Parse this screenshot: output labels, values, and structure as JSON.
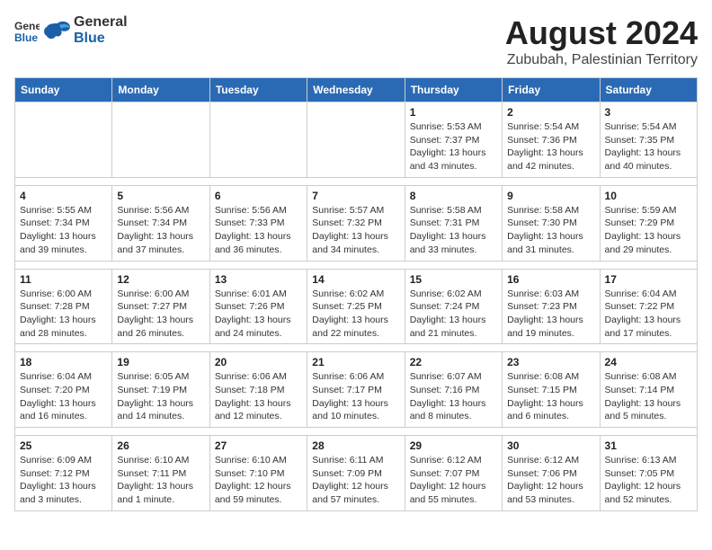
{
  "header": {
    "logo_line1": "General",
    "logo_line2": "Blue",
    "main_title": "August 2024",
    "subtitle": "Zububah, Palestinian Territory"
  },
  "days_of_week": [
    "Sunday",
    "Monday",
    "Tuesday",
    "Wednesday",
    "Thursday",
    "Friday",
    "Saturday"
  ],
  "weeks": [
    {
      "days": [
        {
          "num": "",
          "info": ""
        },
        {
          "num": "",
          "info": ""
        },
        {
          "num": "",
          "info": ""
        },
        {
          "num": "",
          "info": ""
        },
        {
          "num": "1",
          "info": "Sunrise: 5:53 AM\nSunset: 7:37 PM\nDaylight: 13 hours\nand 43 minutes."
        },
        {
          "num": "2",
          "info": "Sunrise: 5:54 AM\nSunset: 7:36 PM\nDaylight: 13 hours\nand 42 minutes."
        },
        {
          "num": "3",
          "info": "Sunrise: 5:54 AM\nSunset: 7:35 PM\nDaylight: 13 hours\nand 40 minutes."
        }
      ]
    },
    {
      "days": [
        {
          "num": "4",
          "info": "Sunrise: 5:55 AM\nSunset: 7:34 PM\nDaylight: 13 hours\nand 39 minutes."
        },
        {
          "num": "5",
          "info": "Sunrise: 5:56 AM\nSunset: 7:34 PM\nDaylight: 13 hours\nand 37 minutes."
        },
        {
          "num": "6",
          "info": "Sunrise: 5:56 AM\nSunset: 7:33 PM\nDaylight: 13 hours\nand 36 minutes."
        },
        {
          "num": "7",
          "info": "Sunrise: 5:57 AM\nSunset: 7:32 PM\nDaylight: 13 hours\nand 34 minutes."
        },
        {
          "num": "8",
          "info": "Sunrise: 5:58 AM\nSunset: 7:31 PM\nDaylight: 13 hours\nand 33 minutes."
        },
        {
          "num": "9",
          "info": "Sunrise: 5:58 AM\nSunset: 7:30 PM\nDaylight: 13 hours\nand 31 minutes."
        },
        {
          "num": "10",
          "info": "Sunrise: 5:59 AM\nSunset: 7:29 PM\nDaylight: 13 hours\nand 29 minutes."
        }
      ]
    },
    {
      "days": [
        {
          "num": "11",
          "info": "Sunrise: 6:00 AM\nSunset: 7:28 PM\nDaylight: 13 hours\nand 28 minutes."
        },
        {
          "num": "12",
          "info": "Sunrise: 6:00 AM\nSunset: 7:27 PM\nDaylight: 13 hours\nand 26 minutes."
        },
        {
          "num": "13",
          "info": "Sunrise: 6:01 AM\nSunset: 7:26 PM\nDaylight: 13 hours\nand 24 minutes."
        },
        {
          "num": "14",
          "info": "Sunrise: 6:02 AM\nSunset: 7:25 PM\nDaylight: 13 hours\nand 22 minutes."
        },
        {
          "num": "15",
          "info": "Sunrise: 6:02 AM\nSunset: 7:24 PM\nDaylight: 13 hours\nand 21 minutes."
        },
        {
          "num": "16",
          "info": "Sunrise: 6:03 AM\nSunset: 7:23 PM\nDaylight: 13 hours\nand 19 minutes."
        },
        {
          "num": "17",
          "info": "Sunrise: 6:04 AM\nSunset: 7:22 PM\nDaylight: 13 hours\nand 17 minutes."
        }
      ]
    },
    {
      "days": [
        {
          "num": "18",
          "info": "Sunrise: 6:04 AM\nSunset: 7:20 PM\nDaylight: 13 hours\nand 16 minutes."
        },
        {
          "num": "19",
          "info": "Sunrise: 6:05 AM\nSunset: 7:19 PM\nDaylight: 13 hours\nand 14 minutes."
        },
        {
          "num": "20",
          "info": "Sunrise: 6:06 AM\nSunset: 7:18 PM\nDaylight: 13 hours\nand 12 minutes."
        },
        {
          "num": "21",
          "info": "Sunrise: 6:06 AM\nSunset: 7:17 PM\nDaylight: 13 hours\nand 10 minutes."
        },
        {
          "num": "22",
          "info": "Sunrise: 6:07 AM\nSunset: 7:16 PM\nDaylight: 13 hours\nand 8 minutes."
        },
        {
          "num": "23",
          "info": "Sunrise: 6:08 AM\nSunset: 7:15 PM\nDaylight: 13 hours\nand 6 minutes."
        },
        {
          "num": "24",
          "info": "Sunrise: 6:08 AM\nSunset: 7:14 PM\nDaylight: 13 hours\nand 5 minutes."
        }
      ]
    },
    {
      "days": [
        {
          "num": "25",
          "info": "Sunrise: 6:09 AM\nSunset: 7:12 PM\nDaylight: 13 hours\nand 3 minutes."
        },
        {
          "num": "26",
          "info": "Sunrise: 6:10 AM\nSunset: 7:11 PM\nDaylight: 13 hours\nand 1 minute."
        },
        {
          "num": "27",
          "info": "Sunrise: 6:10 AM\nSunset: 7:10 PM\nDaylight: 12 hours\nand 59 minutes."
        },
        {
          "num": "28",
          "info": "Sunrise: 6:11 AM\nSunset: 7:09 PM\nDaylight: 12 hours\nand 57 minutes."
        },
        {
          "num": "29",
          "info": "Sunrise: 6:12 AM\nSunset: 7:07 PM\nDaylight: 12 hours\nand 55 minutes."
        },
        {
          "num": "30",
          "info": "Sunrise: 6:12 AM\nSunset: 7:06 PM\nDaylight: 12 hours\nand 53 minutes."
        },
        {
          "num": "31",
          "info": "Sunrise: 6:13 AM\nSunset: 7:05 PM\nDaylight: 12 hours\nand 52 minutes."
        }
      ]
    }
  ]
}
